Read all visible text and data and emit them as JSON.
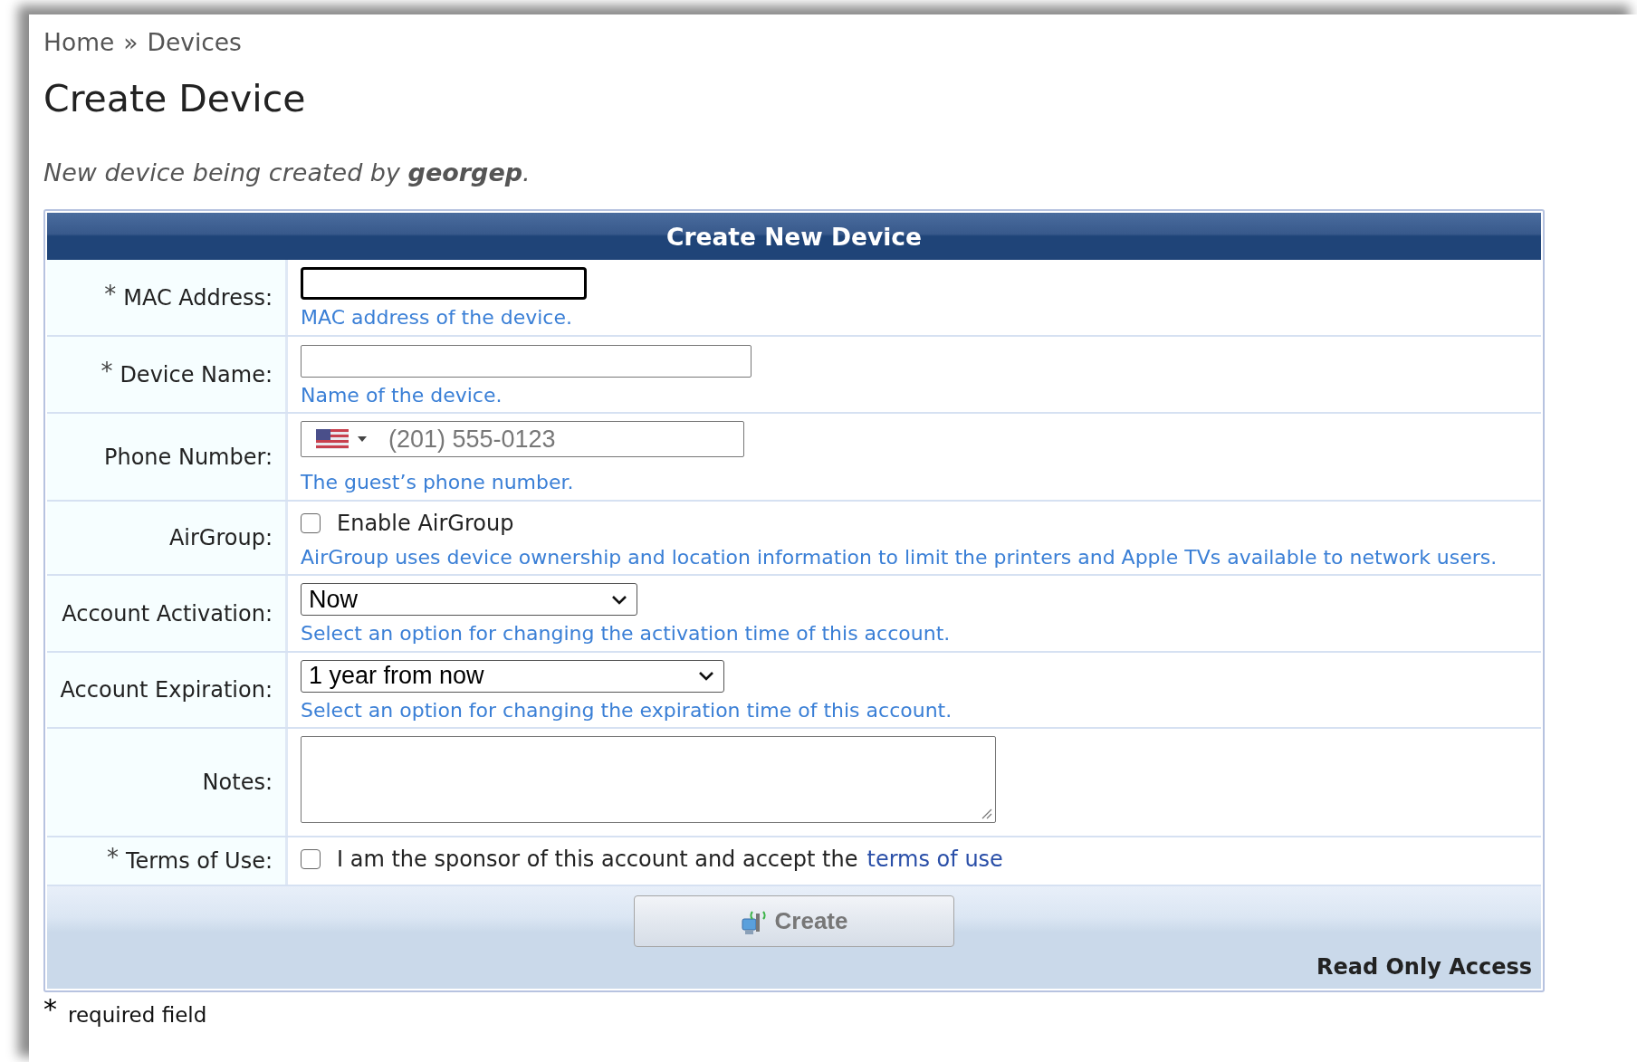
{
  "breadcrumb": {
    "items": [
      "Home",
      "Devices"
    ],
    "separator": "»"
  },
  "title": "Create Device",
  "subtitle": "New device being created by **georgep**.",
  "form": {
    "title": "Create New Device",
    "rows": [
      {
        "kind": "text",
        "required_mark": "*",
        "label": "MAC Address:",
        "focused": true,
        "hint": "MAC address of the device."
      },
      {
        "kind": "text",
        "required_mark": "*",
        "label": "Device Name:",
        "focused": false,
        "hint": "Name of the device."
      },
      {
        "kind": "phone",
        "label": "Phone Number:",
        "placeholder": "(201) 555-0123",
        "hint": "The guest’s phone number."
      },
      {
        "kind": "checkbox",
        "label": "AirGroup:",
        "checked": false,
        "checkbox_label": "Enable AirGroup",
        "hint": "AirGroup uses device ownership and location information to limit the printers and Apple TVs available to network users."
      },
      {
        "kind": "select",
        "label": "Account Activation:",
        "value": "Now",
        "hint": "Select an option for changing the activation time of this account."
      },
      {
        "kind": "select",
        "label": "Account Expiration:",
        "value": "1 year from now",
        "hint": "Select an option for changing the expiration time of this account."
      },
      {
        "kind": "textarea",
        "label": "Notes:"
      },
      {
        "kind": "checkbox",
        "required_mark": "*",
        "label": "Terms of Use:",
        "checked": false,
        "checkbox_label": "I am the sponsor of this account and accept the",
        "link": "terms of use"
      }
    ],
    "button": "Create",
    "status": "Read Only Access"
  },
  "required_note": {
    "mark": "*",
    "text": "required field"
  }
}
